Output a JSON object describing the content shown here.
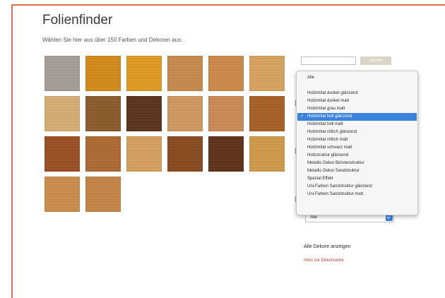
{
  "page": {
    "title": "Folienfinder",
    "subtitle": "Wählen Sie hier aus über 150 Farben und Dekoren aus:"
  },
  "search": {
    "placeholder": "",
    "button_label": "suchen"
  },
  "swatches": [
    {
      "color": "#a59d96",
      "rows": 0,
      "col": 0
    },
    {
      "color": "#d48a1a",
      "rows": 0,
      "col": 1
    },
    {
      "color": "#e09a1e",
      "rows": 0,
      "col": 2
    },
    {
      "color": "#c88a4c",
      "rows": 0,
      "col": 3
    },
    {
      "color": "#cc8a48",
      "rows": 0,
      "col": 4
    },
    {
      "color": "#d8a460",
      "rows": 0,
      "col": 5
    },
    {
      "color": "#d8ac74",
      "rows": 1,
      "col": 0
    },
    {
      "color": "#8c5a2a",
      "rows": 1,
      "col": 1
    },
    {
      "color": "#5a321a",
      "rows": 1,
      "col": 2
    },
    {
      "color": "#d29860",
      "rows": 1,
      "col": 3
    },
    {
      "color": "#cc8a54",
      "rows": 1,
      "col": 4
    },
    {
      "color": "#a86024",
      "rows": 1,
      "col": 5
    },
    {
      "color": "#9c4e22",
      "rows": 2,
      "col": 0
    },
    {
      "color": "#ae6a30",
      "rows": 2,
      "col": 1
    },
    {
      "color": "#d6a060",
      "rows": 2,
      "col": 2
    },
    {
      "color": "#8a4a1e",
      "rows": 2,
      "col": 3
    },
    {
      "color": "#5e3018",
      "rows": 2,
      "col": 4
    },
    {
      "color": "#d09a4a",
      "rows": 2,
      "col": 5
    },
    {
      "color": "#cc8c4c",
      "rows": 3,
      "col": 0
    },
    {
      "color": "#c68446",
      "rows": 3,
      "col": 1
    }
  ],
  "dropdown": {
    "first_option": "Alle",
    "selected_index": 4,
    "options": [
      "Holzimitat dunkel glänzend",
      "Holzimitat dunkel matt",
      "Holzimitat grau matt",
      "Holzimitat hell glänzend",
      "Holzimitat hell matt",
      "Holzimitat rötlich glänzend",
      "Holzimitat rötlich matt",
      "Holzimitat schwarz matt",
      "Holzstruktur glänzend",
      "Metallic-Dekor Bürstenstruktur",
      "Metallic-Dekor Sandstruktur",
      "Spezial Effekt",
      "Uni-Farben Sandstruktur glänzend",
      "Uni-Farben Sandstruktur matt"
    ]
  },
  "filter_select": {
    "value": "Alle"
  },
  "links": {
    "show_all": "Alle Dekore anzeigen",
    "tips": "Infos zur Dekorsuche"
  },
  "colors": {
    "frame": "#e06d4c",
    "selection": "#3a83dc",
    "link_red": "#c0392b"
  }
}
